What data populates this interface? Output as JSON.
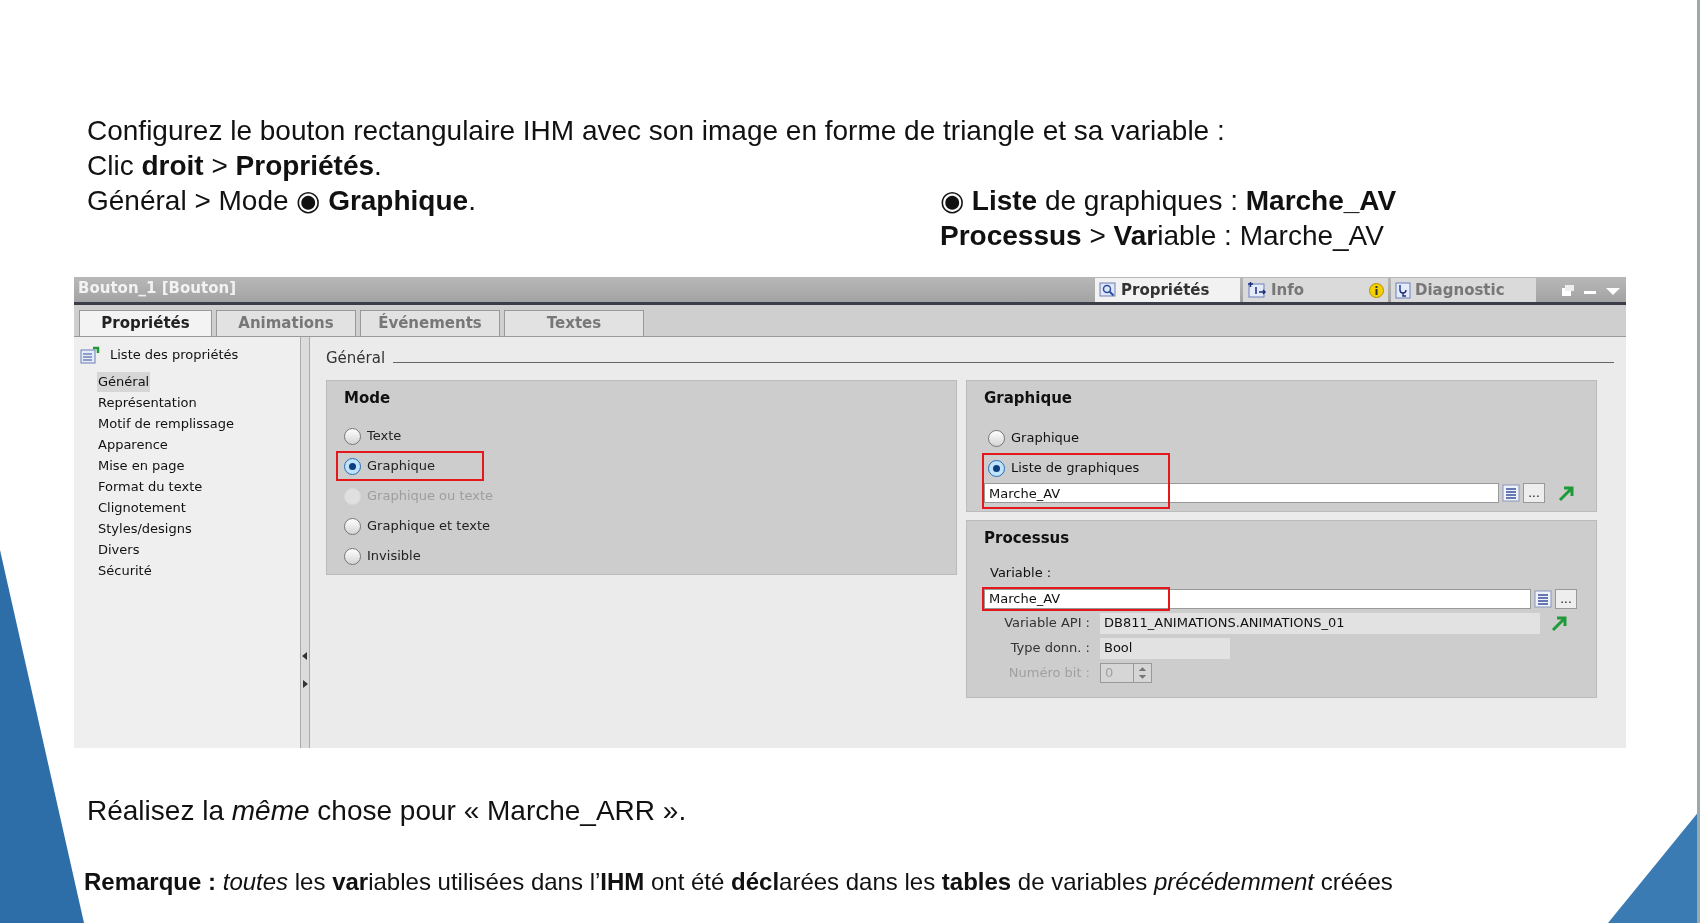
{
  "instructions": {
    "left": [
      "Configurez le bouton rectangulaire IHM avec son image en forme de triangle et sa variable :",
      "Clic **droit** > **Propriétés**.",
      "Général > Mode ◉ **Graphique**."
    ],
    "right": [
      "◉ **Liste** de graphiques : **Marche_AV**",
      "**Processus** > **Var**iable :  Marche_AV"
    ]
  },
  "window": {
    "title": "Bouton_1 [Bouton]",
    "top_tabs": [
      {
        "label": "Propriétés",
        "selected": true,
        "kind": "magnifier"
      },
      {
        "label": "Info",
        "selected": false,
        "kind": "info"
      },
      {
        "label": "Diagnostic",
        "selected": false,
        "kind": "diagnostic"
      }
    ],
    "tabs": [
      {
        "label": "Propriétés",
        "selected": true
      },
      {
        "label": "Animations",
        "selected": false
      },
      {
        "label": "Événements",
        "selected": false
      },
      {
        "label": "Textes",
        "selected": false
      }
    ],
    "sidebar": {
      "header": "Liste des propriétés",
      "items": [
        {
          "label": "Général",
          "selected": true
        },
        {
          "label": "Représentation",
          "selected": false
        },
        {
          "label": "Motif de remplissage",
          "selected": false
        },
        {
          "label": "Apparence",
          "selected": false
        },
        {
          "label": "Mise en page",
          "selected": false
        },
        {
          "label": "Format du texte",
          "selected": false
        },
        {
          "label": "Clignotement",
          "selected": false
        },
        {
          "label": "Styles/designs",
          "selected": false
        },
        {
          "label": "Divers",
          "selected": false
        },
        {
          "label": "Sécurité",
          "selected": false
        }
      ]
    },
    "section": "Général",
    "mode": {
      "title": "Mode",
      "options": [
        {
          "label": "Texte",
          "selected": false,
          "disabled": false,
          "highlighted": false
        },
        {
          "label": "Graphique",
          "selected": true,
          "disabled": false,
          "highlighted": true
        },
        {
          "label": "Graphique ou texte",
          "selected": false,
          "disabled": true,
          "highlighted": false
        },
        {
          "label": "Graphique et texte",
          "selected": false,
          "disabled": false,
          "highlighted": false
        },
        {
          "label": "Invisible",
          "selected": false,
          "disabled": false,
          "highlighted": false
        }
      ]
    },
    "graphic": {
      "title": "Graphique",
      "options": [
        {
          "label": "Graphique",
          "selected": false,
          "highlighted": false
        },
        {
          "label": "Liste de graphiques",
          "selected": true,
          "highlighted": true
        }
      ],
      "field": {
        "value": "Marche_AV",
        "button": "..."
      }
    },
    "process": {
      "title": "Processus",
      "variable_label": "Variable :",
      "variable": {
        "value": "Marche_AV",
        "highlighted": true,
        "button": "..."
      },
      "rows": [
        {
          "label": "Variable API :",
          "value": "DB811_ANIMATIONS.ANIMATIONS_01",
          "kind": "wide",
          "disabled": false
        },
        {
          "label": "Type donn. :",
          "value": "Bool",
          "kind": "short",
          "disabled": false
        },
        {
          "label": "Numéro bit :",
          "value": "0",
          "kind": "spinner",
          "disabled": true
        }
      ]
    }
  },
  "footer": [
    "Réalisez la *même* chose pour  « Marche_ARR ».",
    "**Remarque :** *toutes* les **var**iables utilisées dans l’**IHM** ont été **décl**arées dans les **tables** de variables *précédemment* créées"
  ]
}
